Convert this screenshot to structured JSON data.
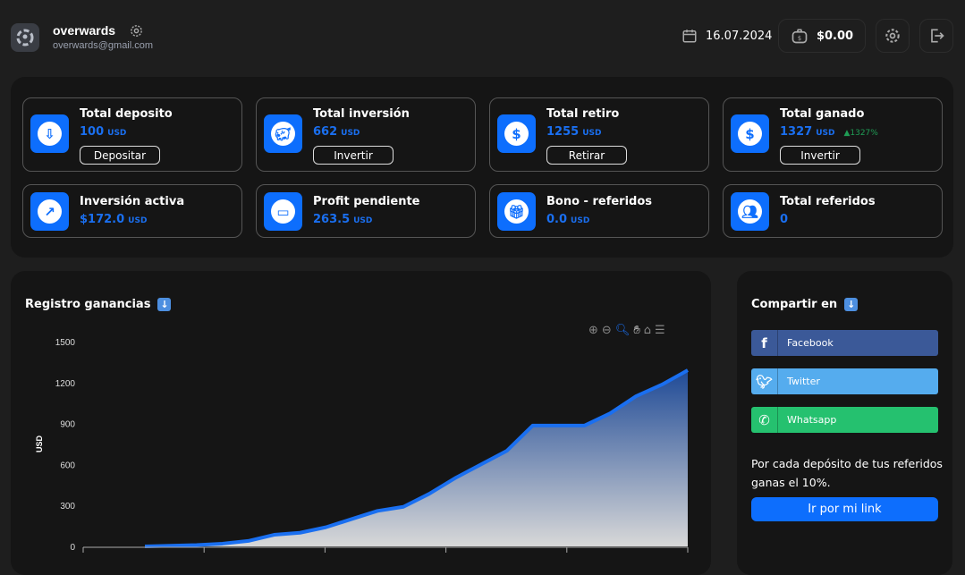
{
  "header": {
    "username": "overwards",
    "email": "overwards@gmail.com",
    "date": "16.07.2024",
    "balance": "$0.00"
  },
  "cards": [
    {
      "title": "Total deposito",
      "value": "100",
      "unit": "USD",
      "button": "Depositar",
      "icon": "money-deposit-icon"
    },
    {
      "title": "Total inversión",
      "value": "662",
      "unit": "USD",
      "button": "Invertir",
      "icon": "piggy-bank-icon"
    },
    {
      "title": "Total retiro",
      "value": "1255",
      "unit": "USD",
      "button": "Retirar",
      "icon": "withdraw-icon"
    },
    {
      "title": "Total ganado",
      "value": "1327",
      "unit": "USD",
      "badge": "▲1327%",
      "button": "Invertir",
      "icon": "dollar-icon"
    },
    {
      "title": "Inversión activa",
      "value": "$172.0",
      "unit": "USD",
      "icon": "chart-monitor-icon"
    },
    {
      "title": "Profit pendiente",
      "value": "263.5",
      "unit": "USD",
      "icon": "wallet-icon"
    },
    {
      "title": "Bono - referidos",
      "value": "0.0",
      "unit": "USD",
      "icon": "gift-icon"
    },
    {
      "title": "Total referidos",
      "value": "0",
      "icon": "people-icon"
    }
  ],
  "chart_panel": {
    "title": "Registro ganancias"
  },
  "chart_data": {
    "type": "area",
    "ylabel": "USD",
    "ylim": [
      0,
      1500
    ],
    "yticks": [
      0,
      300,
      600,
      900,
      1200,
      1500
    ],
    "grid": false,
    "values": [
      0,
      5,
      10,
      20,
      40,
      85,
      100,
      140,
      200,
      260,
      290,
      385,
      500,
      600,
      700,
      885,
      885,
      885,
      975,
      1100,
      1185,
      1290
    ],
    "colors": {
      "line": "#1a6ff0",
      "fill_top": "#1f4a96",
      "fill_bottom": "#d8d8d8"
    }
  },
  "share": {
    "title": "Compartir en",
    "items": [
      {
        "label": "Facebook",
        "color": "#3b5998",
        "icon": "facebook-icon"
      },
      {
        "label": "Twitter",
        "color": "#55acee",
        "icon": "twitter-icon"
      },
      {
        "label": "Whatsapp",
        "color": "#25c16f",
        "icon": "whatsapp-icon"
      }
    ],
    "text": "Por cada depósito de tus referidos ganas el 10%.",
    "button": "Ir por mi link"
  }
}
